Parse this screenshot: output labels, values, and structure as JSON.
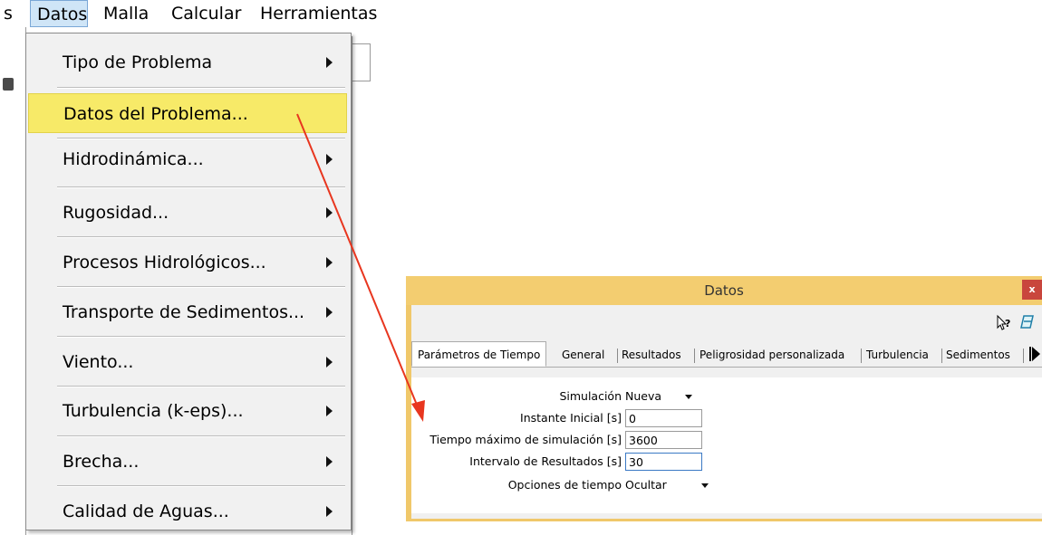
{
  "menubar": {
    "items": [
      "s",
      "Datos",
      "Malla",
      "Calcular",
      "Herramientas"
    ]
  },
  "dropdown": {
    "items": [
      {
        "label": "Tipo de Problema",
        "submenu": true
      },
      {
        "label": "Datos del Problema...",
        "submenu": false,
        "highlighted": true
      },
      {
        "label": "Hidrodinámica...",
        "submenu": true
      },
      {
        "label": "Rugosidad...",
        "submenu": true
      },
      {
        "label": "Procesos Hidrológicos...",
        "submenu": true
      },
      {
        "label": "Transporte de Sedimentos...",
        "submenu": true
      },
      {
        "label": "Viento...",
        "submenu": true
      },
      {
        "label": "Turbulencia (k-eps)...",
        "submenu": true
      },
      {
        "label": "Brecha...",
        "submenu": true
      },
      {
        "label": "Calidad de Aguas...",
        "submenu": true
      }
    ]
  },
  "dialog": {
    "title": "Datos",
    "close_label": "x",
    "help_icon": "context-help-icon",
    "eraser_icon": "eraser-icon",
    "tabs": [
      "Parámetros de Tiempo",
      "General",
      "Resultados",
      "Peligrosidad personalizada",
      "Turbulencia",
      "Sedimentos"
    ],
    "fields": {
      "simulacion": {
        "label": "Simulación",
        "value": "Nueva"
      },
      "instante_inicial": {
        "label": "Instante Inicial [s]",
        "value": "0"
      },
      "tiempo_maximo": {
        "label": "Tiempo máximo de simulación [s]",
        "value": "3600"
      },
      "intervalo_resultados": {
        "label": "Intervalo de Resultados [s]",
        "value": "30"
      },
      "opciones_tiempo": {
        "label": "Opciones de tiempo",
        "value": "Ocultar"
      }
    }
  },
  "colors": {
    "highlight": "#f7ea68",
    "dialog_frame": "#f0c86a",
    "close_button": "#c9463d",
    "annotation_arrow": "#e8361f"
  }
}
